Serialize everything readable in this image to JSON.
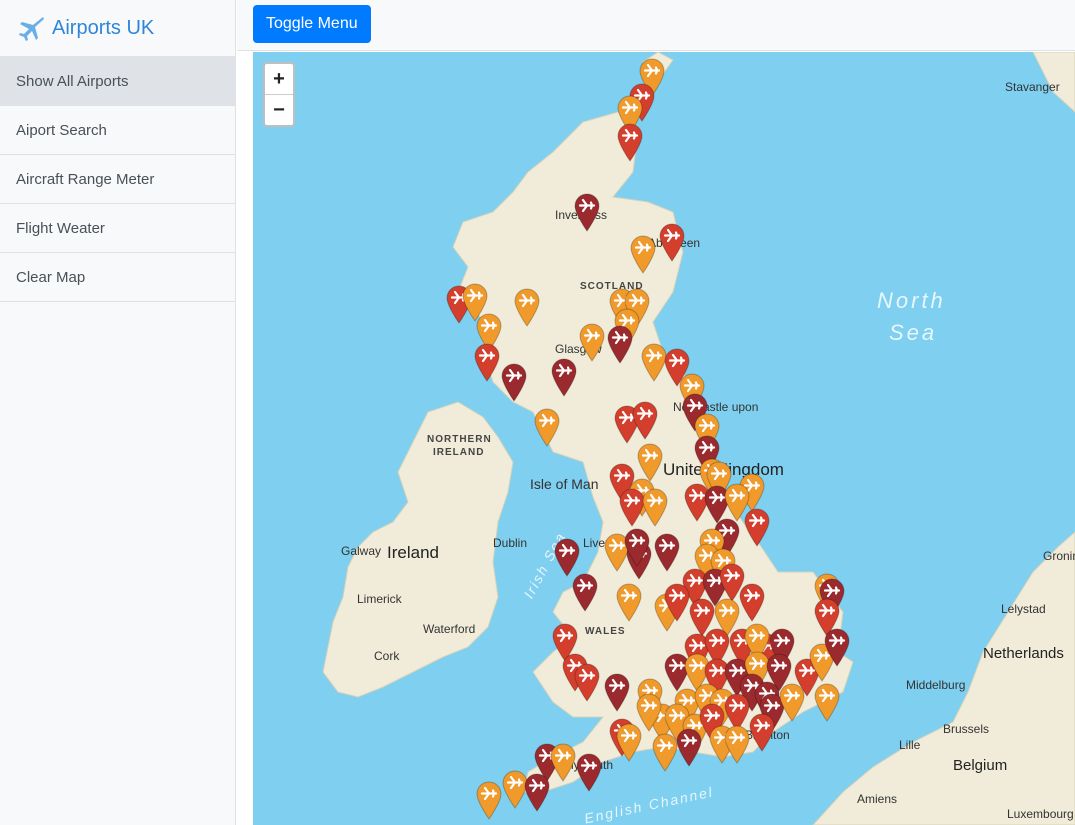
{
  "sidebar": {
    "brand_title": "Airports UK",
    "brand_icon": "airplane-icon",
    "items": [
      {
        "label": "Show All Airports",
        "active": true
      },
      {
        "label": "Aiport Search"
      },
      {
        "label": "Aircraft Range Meter"
      },
      {
        "label": "Flight Weater"
      },
      {
        "label": "Clear Map"
      }
    ]
  },
  "topbar": {
    "toggle_label": "Toggle Menu"
  },
  "map": {
    "zoom_in": "+",
    "zoom_out": "−",
    "labels": {
      "stavanger": "Stavanger",
      "inverness": "Inverness",
      "aberdeen": "Aberdeen",
      "scotland": "SCOTLAND",
      "north": "North",
      "sea": "Sea",
      "glasgow": "Glasgow",
      "newcastle": "Newcastle upon",
      "northern_ireland_1": "NORTHERN",
      "northern_ireland_2": "IRELAND",
      "isle_of_man": "Isle of Man",
      "united_kingdom": "United Kingdom",
      "dublin": "Dublin",
      "ireland": "Ireland",
      "galway": "Galway",
      "irish_sea": "Irish Sea",
      "liverpool": "Liverpool",
      "limerick": "Limerick",
      "waterford": "Waterford",
      "wales": "WALES",
      "cork": "Cork",
      "leylstad": "Lelystad",
      "netherlands": "Netherlands",
      "middelburg": "Middelburg",
      "brussels": "Brussels",
      "belgium": "Belgium",
      "lille": "Lille",
      "amiens": "Amiens",
      "luxembourg": "Luxembourg",
      "groningen": "Groningen",
      "plymouth": "Plymouth",
      "brighton": "Brighton",
      "english_channel": "English Channel"
    },
    "marker_colors": {
      "orange": "#ef9a2b",
      "red": "#d33f2c",
      "darkred": "#9b2a2f"
    }
  }
}
